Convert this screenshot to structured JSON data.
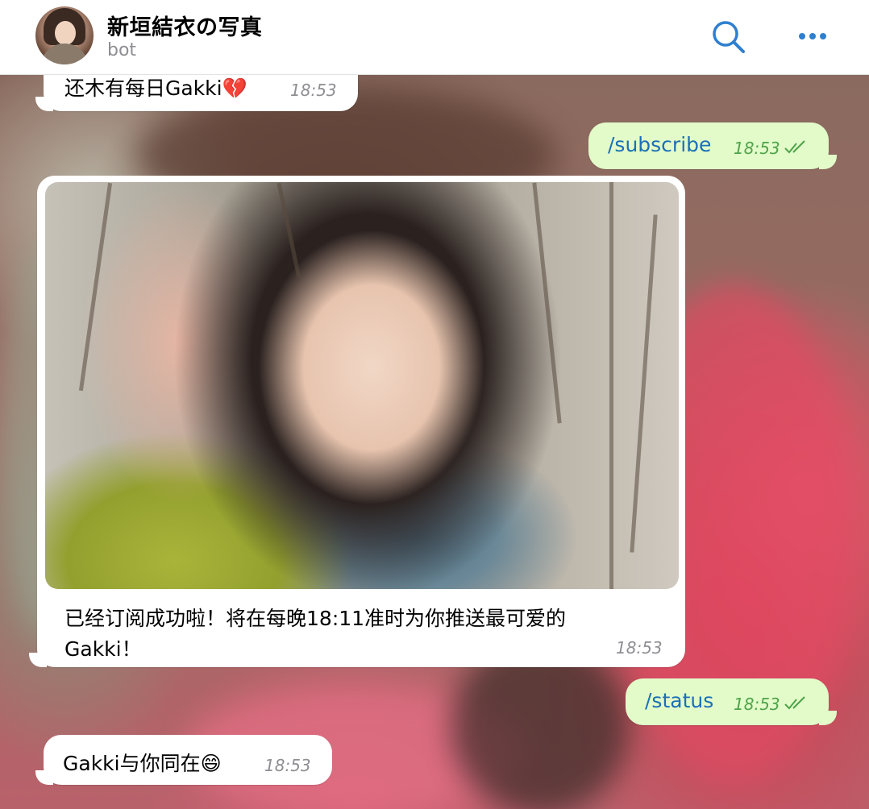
{
  "header": {
    "title": "新垣結衣の写真",
    "subtitle": "bot"
  },
  "messages": [
    {
      "direction": "in",
      "text": "还木有每日Gakki💔",
      "time": "18:53"
    },
    {
      "direction": "out",
      "text": "/subscribe",
      "time": "18:53",
      "status": "read"
    },
    {
      "direction": "in",
      "type": "photo",
      "caption_line1": "已经订阅成功啦！将在每晚18:11准时为你推送最可爱的",
      "caption_line2": "Gakki！",
      "time": "18:53"
    },
    {
      "direction": "out",
      "text": "/status",
      "time": "18:53",
      "status": "read"
    },
    {
      "direction": "in",
      "text": "Gakki与你同在😄",
      "time": "18:53"
    }
  ],
  "icons": {
    "search": "search-icon",
    "more": "more-icon",
    "read": "double-check-icon"
  },
  "colors": {
    "accent": "#2f7fd0",
    "outgoing_bubble": "#e2fbc9",
    "outgoing_text": "#1c6fb8",
    "outgoing_time": "#4fa34a",
    "incoming_bubble": "#ffffff"
  }
}
